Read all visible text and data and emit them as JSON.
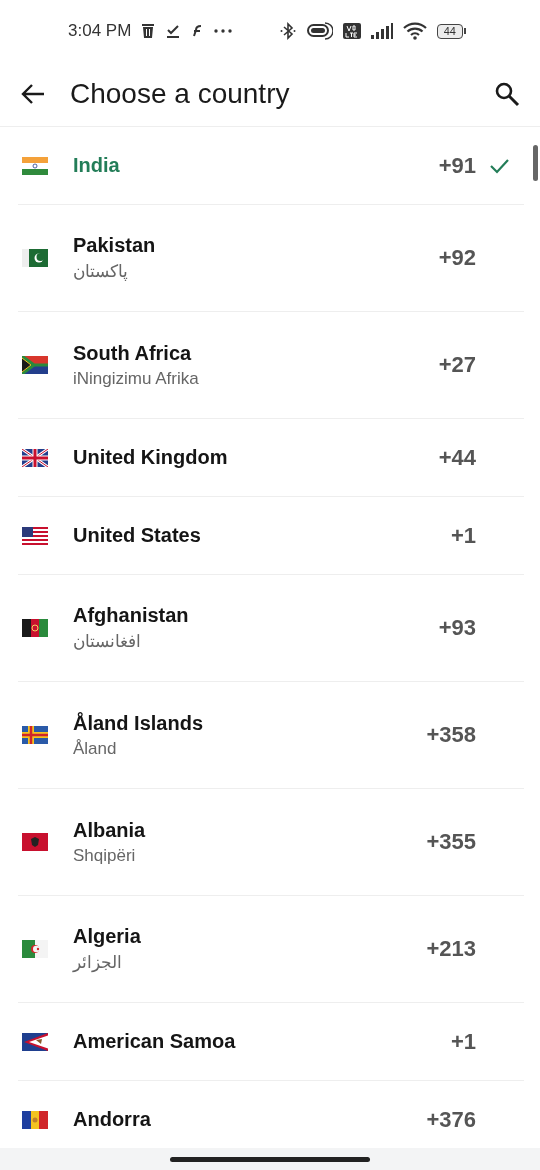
{
  "status_bar": {
    "time": "3:04 PM",
    "battery": "44"
  },
  "header": {
    "title": "Choose a country"
  },
  "countries": [
    {
      "name": "India",
      "code": "+91",
      "selected": true
    },
    {
      "name": "Pakistan",
      "native": "پاکستان",
      "code": "+92",
      "selected": false
    },
    {
      "name": "South Africa",
      "native": "iNingizimu Afrika",
      "code": "+27",
      "selected": false
    },
    {
      "name": "United Kingdom",
      "code": "+44",
      "selected": false
    },
    {
      "name": "United States",
      "code": "+1",
      "selected": false
    },
    {
      "name": "Afghanistan",
      "native": "افغانستان",
      "code": "+93",
      "selected": false
    },
    {
      "name": "Åland Islands",
      "native": "Åland",
      "code": "+358",
      "selected": false
    },
    {
      "name": "Albania",
      "native": "Shqipëri",
      "code": "+355",
      "selected": false
    },
    {
      "name": "Algeria",
      "native": "الجزائر",
      "code": "+213",
      "selected": false
    },
    {
      "name": "American Samoa",
      "code": "+1",
      "selected": false
    },
    {
      "name": "Andorra",
      "code": "+376",
      "selected": false
    }
  ]
}
